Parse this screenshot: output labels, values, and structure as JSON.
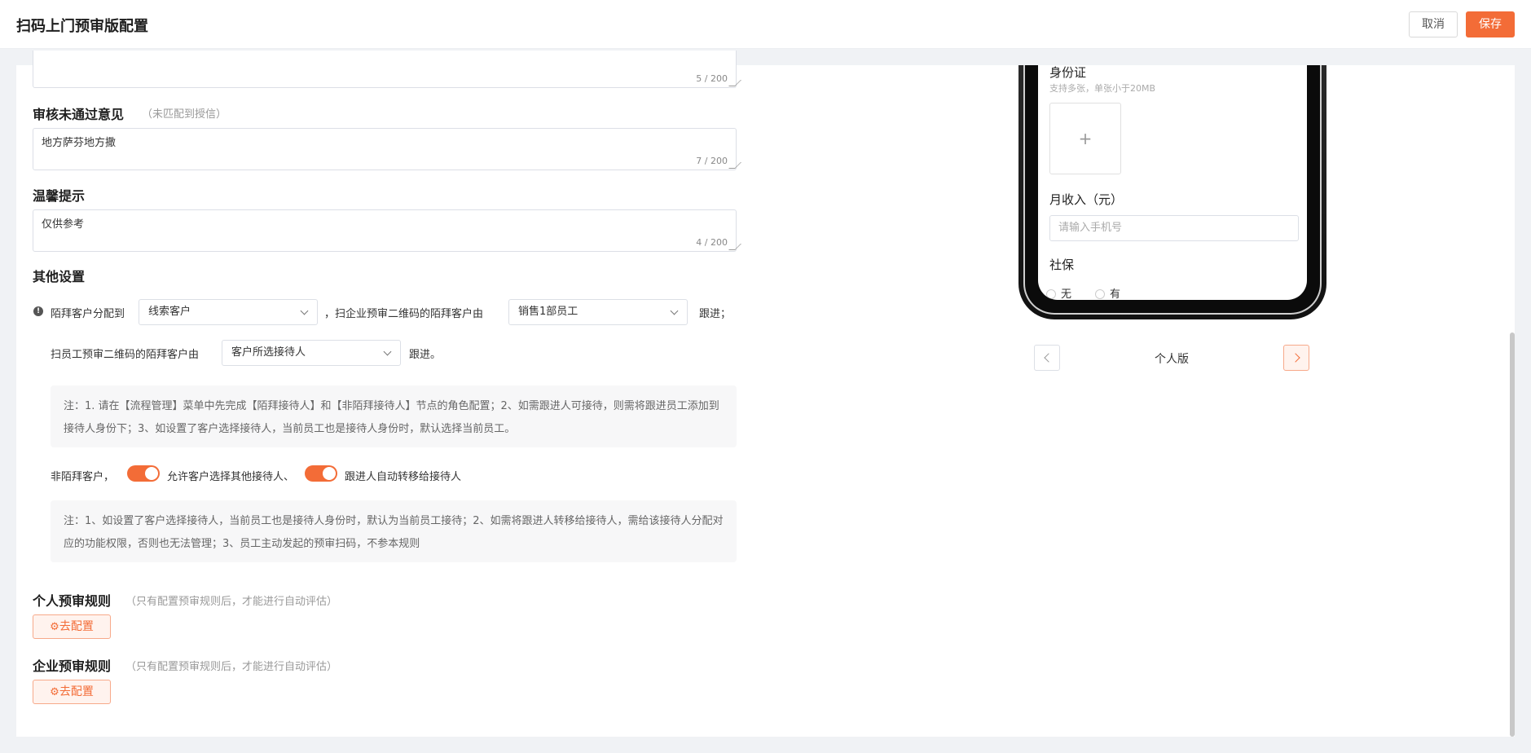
{
  "header": {
    "title": "扫码上门预审版配置",
    "cancel_label": "取消",
    "save_label": "保存"
  },
  "form": {
    "top_textarea": {
      "count": "5 / 200"
    },
    "reject_opinion": {
      "label": "审核未通过意见",
      "hint": "（未匹配到授信）",
      "value": "地方萨芬地方撒",
      "count": "7 / 200"
    },
    "warm_tip": {
      "label": "温馨提示",
      "value": "仅供参考",
      "count": "4 / 200"
    },
    "other_settings": {
      "label": "其他设置",
      "stranger_assign_label": "陌拜客户分配到",
      "stranger_assign_value": "线索客户",
      "enterprise_qr_label": "，扫企业预审二维码的陌拜客户由",
      "enterprise_qr_value": "销售1部员工",
      "follow_suffix_1": "跟进；",
      "employee_qr_label": "扫员工预审二维码的陌拜客户由",
      "employee_qr_value": "客户所选接待人",
      "follow_suffix_2": "跟进。",
      "note1": "注：1. 请在【流程管理】菜单中先完成【陌拜接待人】和【非陌拜接待人】节点的角色配置；2、如需跟进人可接待，则需将跟进员工添加到接待人身份下；3、如设置了客户选择接待人，当前员工也是接待人身份时，默认选择当前员工。",
      "non_stranger_label": "非陌拜客户，",
      "toggle1_label": "允许客户选择其他接待人、",
      "toggle1_on": true,
      "toggle2_label": "跟进人自动转移给接待人",
      "toggle2_on": true,
      "note2": "注：1、如设置了客户选择接待人，当前员工也是接待人身份时，默认为当前员工接待；2、如需将跟进人转移给接待人，需给该接待人分配对应的功能权限，否则也无法管理；3、员工主动发起的预审扫码，不参本规则"
    },
    "personal_rule": {
      "label": "个人预审规则",
      "hint": "（只有配置预审规则后，才能进行自动评估）",
      "button": "去配置"
    },
    "enterprise_rule": {
      "label": "企业预审规则",
      "hint": "（只有配置预审规则后，才能进行自动评估）",
      "button": "去配置"
    }
  },
  "preview": {
    "id_card_label": "身份证",
    "id_card_hint": "支持多张，单张小于20MB",
    "upload_plus": "+",
    "income_label": "月收入（元）",
    "income_placeholder": "请输入手机号",
    "social_label": "社保",
    "radio_no": "无",
    "radio_yes": "有",
    "pager_label": "个人版"
  },
  "colors": {
    "accent": "#f36c37",
    "page_bg": "#f0f2f5"
  }
}
